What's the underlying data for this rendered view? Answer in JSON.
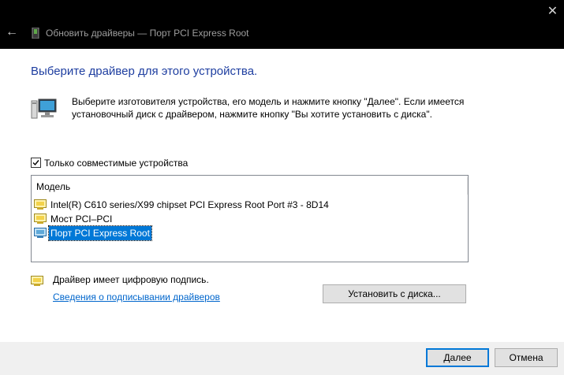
{
  "window": {
    "title": "Обновить драйверы — Порт PCI Express Root",
    "back_glyph": "←",
    "close_glyph": "✕"
  },
  "main": {
    "heading": "Выберите драйвер для этого устройства.",
    "description": "Выберите изготовителя устройства, его модель и нажмите кнопку \"Далее\". Если имеется установочный диск с драйвером, нажмите кнопку \"Вы хотите установить с диска\".",
    "compatible_checkbox": {
      "label": "Только совместимые устройства",
      "checked": true
    },
    "model_list": {
      "header": "Модель",
      "items": [
        {
          "label": "Intel(R) C610 series/X99 chipset PCI Express Root Port #3 - 8D14",
          "selected": false
        },
        {
          "label": "Мост PCI–PCI",
          "selected": false
        },
        {
          "label": "Порт PCI Express Root",
          "selected": true
        }
      ]
    },
    "signed_text": "Драйвер имеет цифровую подпись.",
    "signing_link": "Сведения о подписывании драйверов",
    "install_from_disk_label": "Установить с диска..."
  },
  "footer": {
    "next_label": "Далее",
    "cancel_label": "Отмена"
  },
  "colors": {
    "heading": "#1e3ea0",
    "link": "#0066cc",
    "selection": "#0078d7",
    "titlebar": "#000000"
  }
}
